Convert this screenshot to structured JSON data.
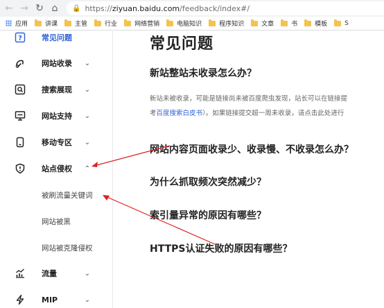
{
  "browser": {
    "url_host": "ziyuan.baidu.com",
    "url_prefix": "https://",
    "url_path": "/feedback/index#/",
    "icons": {
      "back": "back-arrow-icon",
      "forward": "forward-arrow-icon",
      "reload": "reload-icon",
      "home": "home-icon",
      "lock": "lock-icon"
    }
  },
  "bookmarks": [
    {
      "label": "应用",
      "icon": "apps-icon"
    },
    {
      "label": "讲课",
      "icon": "folder-icon"
    },
    {
      "label": "主管",
      "icon": "folder-icon"
    },
    {
      "label": "行业",
      "icon": "folder-icon"
    },
    {
      "label": "网络营销",
      "icon": "folder-icon"
    },
    {
      "label": "电脑知识",
      "icon": "folder-icon"
    },
    {
      "label": "程序知识",
      "icon": "folder-icon"
    },
    {
      "label": "文章",
      "icon": "folder-icon"
    },
    {
      "label": "书",
      "icon": "folder-icon"
    },
    {
      "label": "模板",
      "icon": "folder-icon"
    },
    {
      "label": "S",
      "icon": "folder-icon"
    }
  ],
  "sidebar": {
    "items": [
      {
        "label": "常见问题",
        "icon": "question-icon",
        "active": true
      },
      {
        "label": "网站收录",
        "icon": "index-icon"
      },
      {
        "label": "搜索展现",
        "icon": "search-display-icon"
      },
      {
        "label": "网站支持",
        "icon": "monitor-icon"
      },
      {
        "label": "移动专区",
        "icon": "mobile-icon"
      },
      {
        "label": "站点侵权",
        "icon": "shield-alert-icon",
        "expanded": true
      },
      {
        "label": "流量",
        "icon": "traffic-chart-icon"
      },
      {
        "label": "MIP",
        "icon": "lightning-icon"
      }
    ],
    "sub_items": [
      "被刷流量关键词",
      "网站被黑",
      "网站被克隆侵权"
    ]
  },
  "main": {
    "title": "常见问题",
    "questions": [
      "新站整站未收录怎么办？",
      "网站内容页面收录少、收录慢、不收录怎么办？",
      "为什么抓取频次突然减少？",
      "索引量异常的原因有哪些？",
      "HTTPS认证失败的原因有哪些？"
    ],
    "answer_line1": "新站未被收录，可能是链接尚未被百度爬虫发现，站长可以在链接提",
    "answer_line2_prefix": "考",
    "answer_link": "百度搜索白皮书",
    "answer_line2_suffix": "）。如果链接提交超一周未收录，请点击此处进行"
  },
  "colors": {
    "accent": "#3064d9",
    "arrow": "#e02020"
  }
}
